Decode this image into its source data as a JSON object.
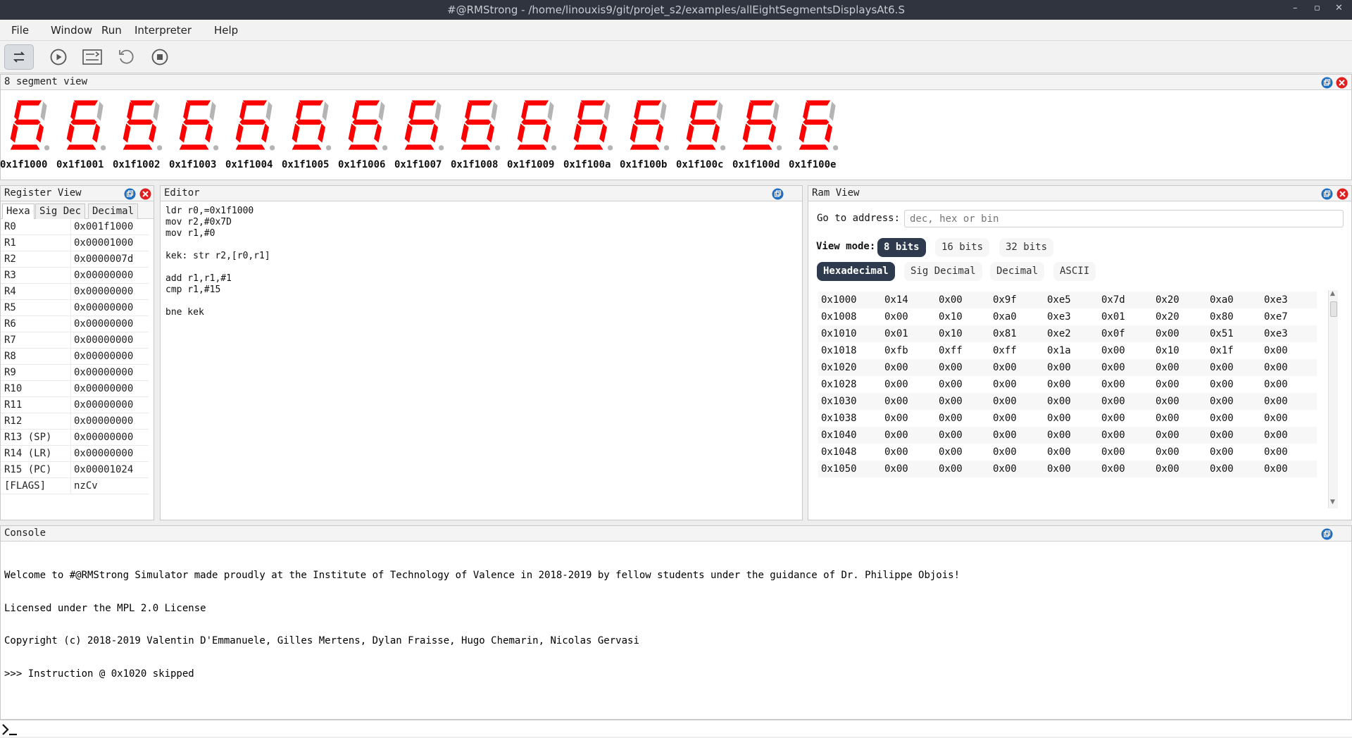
{
  "window": {
    "title": "#@RMStrong - /home/linouxis9/git/projet_s2/examples/allEightSegmentsDisplaysAt6.S"
  },
  "menu": [
    "File",
    "Window",
    "Run",
    "Interpreter",
    "Help"
  ],
  "toolbar": {
    "buttons": [
      "switch-mode",
      "run",
      "step",
      "reload",
      "stop"
    ]
  },
  "segment_view": {
    "title": "8 segment view",
    "digit_color": "#ff0000",
    "off_color": "#b4b4b4",
    "addresses": [
      "0x1f1000",
      "0x1f1001",
      "0x1f1002",
      "0x1f1003",
      "0x1f1004",
      "0x1f1005",
      "0x1f1006",
      "0x1f1007",
      "0x1f1008",
      "0x1f1009",
      "0x1f100a",
      "0x1f100b",
      "0x1f100c",
      "0x1f100d",
      "0x1f100e"
    ]
  },
  "register_view": {
    "title": "Register View",
    "tabs": [
      "Hexa",
      "Sig Dec",
      "Decimal"
    ],
    "rows": [
      {
        "name": "R0",
        "value": "0x001f1000"
      },
      {
        "name": "R1",
        "value": "0x00001000"
      },
      {
        "name": "R2",
        "value": "0x0000007d"
      },
      {
        "name": "R3",
        "value": "0x00000000"
      },
      {
        "name": "R4",
        "value": "0x00000000"
      },
      {
        "name": "R5",
        "value": "0x00000000"
      },
      {
        "name": "R6",
        "value": "0x00000000"
      },
      {
        "name": "R7",
        "value": "0x00000000"
      },
      {
        "name": "R8",
        "value": "0x00000000"
      },
      {
        "name": "R9",
        "value": "0x00000000"
      },
      {
        "name": "R10",
        "value": "0x00000000"
      },
      {
        "name": "R11",
        "value": "0x00000000"
      },
      {
        "name": "R12",
        "value": "0x00000000"
      },
      {
        "name": "R13 (SP)",
        "value": "0x00000000"
      },
      {
        "name": "R14 (LR)",
        "value": "0x00000000"
      },
      {
        "name": "R15 (PC)",
        "value": "0x00001024"
      },
      {
        "name": "[FLAGS]",
        "value": "nzCv"
      }
    ]
  },
  "editor": {
    "title": "Editor",
    "code": "ldr r0,=0x1f1000\nmov r2,#0x7D\nmov r1,#0\n\nkek: str r2,[r0,r1]\n\nadd r1,r1,#1\ncmp r1,#15\n\nbne kek"
  },
  "ram_view": {
    "title": "Ram View",
    "goto_label": "Go to address:",
    "goto_placeholder": "dec, hex or bin",
    "view_mode_label": "View mode:",
    "view_modes": [
      "8 bits",
      "16 bits",
      "32 bits"
    ],
    "formats": [
      "Hexadecimal",
      "Sig Decimal",
      "Decimal",
      "ASCII"
    ],
    "rows": [
      [
        "0x1000",
        "0x14",
        "0x00",
        "0x9f",
        "0xe5",
        "0x7d",
        "0x20",
        "0xa0",
        "0xe3"
      ],
      [
        "0x1008",
        "0x00",
        "0x10",
        "0xa0",
        "0xe3",
        "0x01",
        "0x20",
        "0x80",
        "0xe7"
      ],
      [
        "0x1010",
        "0x01",
        "0x10",
        "0x81",
        "0xe2",
        "0x0f",
        "0x00",
        "0x51",
        "0xe3"
      ],
      [
        "0x1018",
        "0xfb",
        "0xff",
        "0xff",
        "0x1a",
        "0x00",
        "0x10",
        "0x1f",
        "0x00"
      ],
      [
        "0x1020",
        "0x00",
        "0x00",
        "0x00",
        "0x00",
        "0x00",
        "0x00",
        "0x00",
        "0x00"
      ],
      [
        "0x1028",
        "0x00",
        "0x00",
        "0x00",
        "0x00",
        "0x00",
        "0x00",
        "0x00",
        "0x00"
      ],
      [
        "0x1030",
        "0x00",
        "0x00",
        "0x00",
        "0x00",
        "0x00",
        "0x00",
        "0x00",
        "0x00"
      ],
      [
        "0x1038",
        "0x00",
        "0x00",
        "0x00",
        "0x00",
        "0x00",
        "0x00",
        "0x00",
        "0x00"
      ],
      [
        "0x1040",
        "0x00",
        "0x00",
        "0x00",
        "0x00",
        "0x00",
        "0x00",
        "0x00",
        "0x00"
      ],
      [
        "0x1048",
        "0x00",
        "0x00",
        "0x00",
        "0x00",
        "0x00",
        "0x00",
        "0x00",
        "0x00"
      ],
      [
        "0x1050",
        "0x00",
        "0x00",
        "0x00",
        "0x00",
        "0x00",
        "0x00",
        "0x00",
        "0x00"
      ]
    ]
  },
  "console": {
    "title": "Console",
    "lines": [
      "Welcome to #@RMStrong Simulator made proudly at the Institute of Technology of Valence in 2018-2019 by fellow students under the guidance of Dr. Philippe Objois!",
      "Licensed under the MPL 2.0 License",
      "Copyright (c) 2018-2019 Valentin D'Emmanuele, Gilles Mertens, Dylan Fraisse, Hugo Chemarin, Nicolas Gervasi",
      ">>> Instruction @ 0x1020 skipped"
    ]
  }
}
